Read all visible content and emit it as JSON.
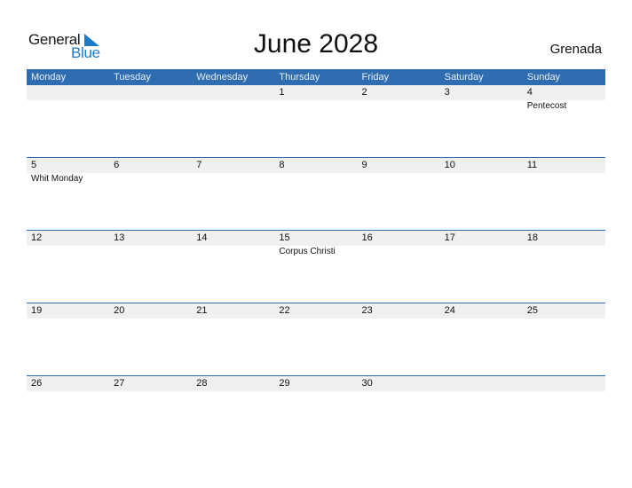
{
  "logo": {
    "word1": "General",
    "word2": "Blue"
  },
  "title": "June 2028",
  "country": "Grenada",
  "colors": {
    "header_bg": "#2f6db0",
    "brand_blue": "#1e7bc9",
    "day_strip": "#f0f0f0"
  },
  "weekdays": [
    "Monday",
    "Tuesday",
    "Wednesday",
    "Thursday",
    "Friday",
    "Saturday",
    "Sunday"
  ],
  "weeks": [
    {
      "days": [
        "",
        "",
        "",
        "1",
        "2",
        "3",
        "4"
      ],
      "events": [
        "",
        "",
        "",
        "",
        "",
        "",
        "Pentecost"
      ]
    },
    {
      "days": [
        "5",
        "6",
        "7",
        "8",
        "9",
        "10",
        "11"
      ],
      "events": [
        "Whit Monday",
        "",
        "",
        "",
        "",
        "",
        ""
      ]
    },
    {
      "days": [
        "12",
        "13",
        "14",
        "15",
        "16",
        "17",
        "18"
      ],
      "events": [
        "",
        "",
        "",
        "Corpus Christi",
        "",
        "",
        ""
      ]
    },
    {
      "days": [
        "19",
        "20",
        "21",
        "22",
        "23",
        "24",
        "25"
      ],
      "events": [
        "",
        "",
        "",
        "",
        "",
        "",
        ""
      ]
    },
    {
      "days": [
        "26",
        "27",
        "28",
        "29",
        "30",
        "",
        ""
      ],
      "events": [
        "",
        "",
        "",
        "",
        "",
        "",
        ""
      ]
    }
  ]
}
